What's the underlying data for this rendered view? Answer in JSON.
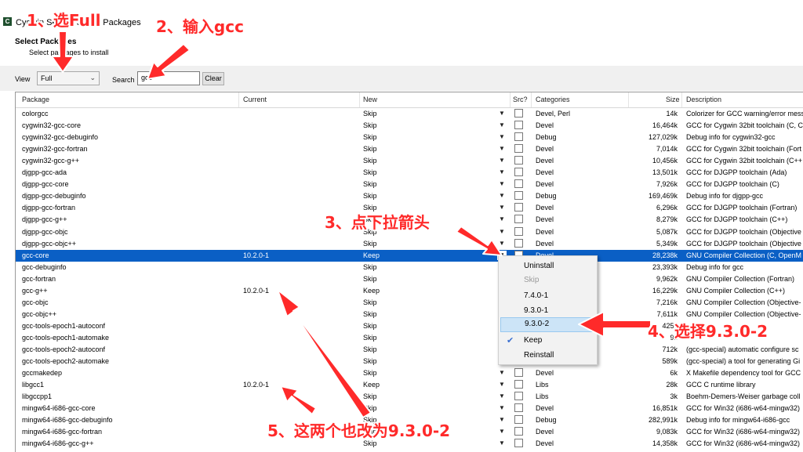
{
  "window": {
    "title": "Cygwin Setup - Select Packages"
  },
  "header": {
    "title": "Select Packages",
    "subtitle": "Select packages to install"
  },
  "toolbar": {
    "view_label": "View",
    "view_value": "Full",
    "search_label": "Search",
    "search_value": "gcc",
    "clear_label": "Clear"
  },
  "columns": [
    "Package",
    "Current",
    "New",
    "Src?",
    "Categories",
    "Size",
    "Description"
  ],
  "rows": [
    {
      "package": "colorgcc",
      "current": "",
      "new": "Skip",
      "category": "Devel, Perl",
      "size": "14k",
      "description": "Colorizer for GCC warning/error mess"
    },
    {
      "package": "cygwin32-gcc-core",
      "current": "",
      "new": "Skip",
      "category": "Devel",
      "size": "16,464k",
      "description": "GCC for Cygwin 32bit toolchain (C, C"
    },
    {
      "package": "cygwin32-gcc-debuginfo",
      "current": "",
      "new": "Skip",
      "category": "Debug",
      "size": "127,029k",
      "description": "Debug info for cygwin32-gcc"
    },
    {
      "package": "cygwin32-gcc-fortran",
      "current": "",
      "new": "Skip",
      "category": "Devel",
      "size": "7,014k",
      "description": "GCC for Cygwin 32bit toolchain (Fort"
    },
    {
      "package": "cygwin32-gcc-g++",
      "current": "",
      "new": "Skip",
      "category": "Devel",
      "size": "10,456k",
      "description": "GCC for Cygwin 32bit toolchain (C++"
    },
    {
      "package": "djgpp-gcc-ada",
      "current": "",
      "new": "Skip",
      "category": "Devel",
      "size": "13,501k",
      "description": "GCC for DJGPP toolchain (Ada)"
    },
    {
      "package": "djgpp-gcc-core",
      "current": "",
      "new": "Skip",
      "category": "Devel",
      "size": "7,926k",
      "description": "GCC for DJGPP toolchain (C)"
    },
    {
      "package": "djgpp-gcc-debuginfo",
      "current": "",
      "new": "Skip",
      "category": "Debug",
      "size": "169,469k",
      "description": "Debug info for djgpp-gcc"
    },
    {
      "package": "djgpp-gcc-fortran",
      "current": "",
      "new": "Skip",
      "category": "Devel",
      "size": "6,296k",
      "description": "GCC for DJGPP toolchain (Fortran)"
    },
    {
      "package": "djgpp-gcc-g++",
      "current": "",
      "new": "Skip",
      "category": "Devel",
      "size": "8,279k",
      "description": "GCC for DJGPP toolchain (C++)"
    },
    {
      "package": "djgpp-gcc-objc",
      "current": "",
      "new": "Skip",
      "category": "Devel",
      "size": "5,087k",
      "description": "GCC for DJGPP toolchain (Objective"
    },
    {
      "package": "djgpp-gcc-objc++",
      "current": "",
      "new": "Skip",
      "category": "Devel",
      "size": "5,349k",
      "description": "GCC for DJGPP toolchain (Objective"
    },
    {
      "package": "gcc-core",
      "current": "10.2.0-1",
      "new": "Keep",
      "category": "Devel",
      "size": "28,238k",
      "description": "GNU Compiler Collection (C, OpenM"
    },
    {
      "package": "gcc-debuginfo",
      "current": "",
      "new": "Skip",
      "category": "",
      "size": "23,393k",
      "description": "Debug info for gcc"
    },
    {
      "package": "gcc-fortran",
      "current": "",
      "new": "Skip",
      "category": "",
      "size": "9,962k",
      "description": "GNU Compiler Collection (Fortran)"
    },
    {
      "package": "gcc-g++",
      "current": "10.2.0-1",
      "new": "Keep",
      "category": "",
      "size": "16,229k",
      "description": "GNU Compiler Collection (C++)"
    },
    {
      "package": "gcc-objc",
      "current": "",
      "new": "Skip",
      "category": "",
      "size": "7,216k",
      "description": "GNU Compiler Collection (Objective-"
    },
    {
      "package": "gcc-objc++",
      "current": "",
      "new": "Skip",
      "category": "",
      "size": "7,611k",
      "description": "GNU Compiler Collection (Objective-"
    },
    {
      "package": "gcc-tools-epoch1-autoconf",
      "current": "",
      "new": "Skip",
      "category": "",
      "size": "425k",
      "description": ""
    },
    {
      "package": "gcc-tools-epoch1-automake",
      "current": "",
      "new": "Skip",
      "category": "",
      "size": "9k",
      "description": ""
    },
    {
      "package": "gcc-tools-epoch2-autoconf",
      "current": "",
      "new": "Skip",
      "category": "",
      "size": "712k",
      "description": "(gcc-special) automatic configure sc"
    },
    {
      "package": "gcc-tools-epoch2-automake",
      "current": "",
      "new": "Skip",
      "category": "",
      "size": "589k",
      "description": "(gcc-special) a tool for generating Gi"
    },
    {
      "package": "gccmakedep",
      "current": "",
      "new": "Skip",
      "category": "Devel",
      "size": "6k",
      "description": "X Makefile dependency tool for GCC"
    },
    {
      "package": "libgcc1",
      "current": "10.2.0-1",
      "new": "Keep",
      "category": "Libs",
      "size": "28k",
      "description": "GCC C runtime library"
    },
    {
      "package": "libgccpp1",
      "current": "",
      "new": "Skip",
      "category": "Libs",
      "size": "3k",
      "description": "Boehm-Demers-Weiser garbage coll"
    },
    {
      "package": "mingw64-i686-gcc-core",
      "current": "",
      "new": "Skip",
      "category": "Devel",
      "size": "16,851k",
      "description": "GCC for Win32 (i686-w64-mingw32)"
    },
    {
      "package": "mingw64-i686-gcc-debuginfo",
      "current": "",
      "new": "Skip",
      "category": "Debug",
      "size": "282,991k",
      "description": "Debug info for mingw64-i686-gcc"
    },
    {
      "package": "mingw64-i686-gcc-fortran",
      "current": "",
      "new": "Skip",
      "category": "Devel",
      "size": "9,083k",
      "description": "GCC for Win32 (i686-w64-mingw32)"
    },
    {
      "package": "mingw64-i686-gcc-g++",
      "current": "",
      "new": "Skip",
      "category": "Devel",
      "size": "14,358k",
      "description": "GCC for Win32 (i686-w64-mingw32)"
    }
  ],
  "menu": {
    "items": [
      {
        "label": "Uninstall",
        "disabled": false
      },
      {
        "label": "Skip",
        "disabled": true
      },
      {
        "label": "7.4.0-1",
        "disabled": false
      },
      {
        "label": "9.3.0-1",
        "disabled": false
      },
      {
        "label": "9.3.0-2",
        "disabled": false,
        "highlighted": true
      },
      {
        "label": "Keep",
        "disabled": false,
        "checked": true
      },
      {
        "label": "Reinstall",
        "disabled": false
      }
    ]
  },
  "annotations": {
    "step1": "1、选Full",
    "step2": "2、输入gcc",
    "step3": "3、点下拉箭头",
    "step4": "4、选择9.3.0-2",
    "step5": "5、这两个也改为9.3.0-2"
  },
  "colors": {
    "selection": "#0a5fc5",
    "annotation": "#ff2a2a",
    "menu_highlight": "#cce4f7"
  }
}
